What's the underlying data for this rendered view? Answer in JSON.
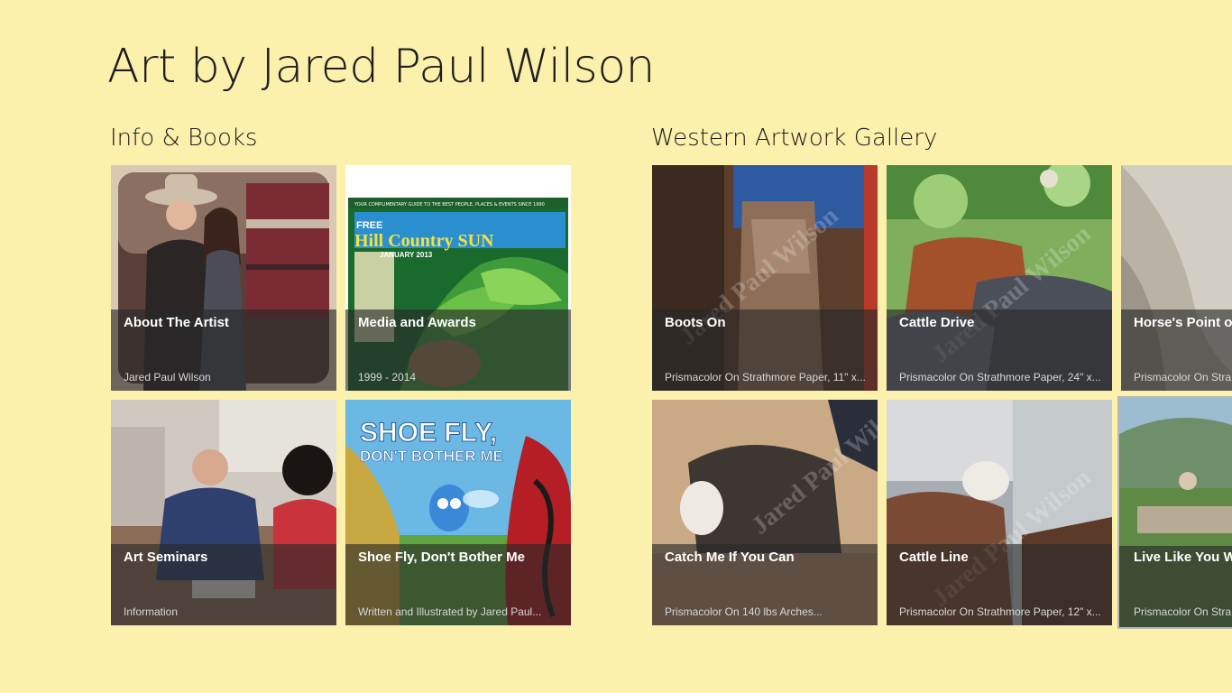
{
  "app_title": "Art by Jared Paul Wilson",
  "sections": {
    "info": {
      "header": "Info & Books",
      "tiles": [
        {
          "title": "About The Artist",
          "subtitle": "Jared Paul Wilson"
        },
        {
          "title": "Media and Awards",
          "subtitle": "1999 - 2014"
        },
        {
          "title": "Art Seminars",
          "subtitle": "Information"
        },
        {
          "title": "Shoe Fly, Don't Bother Me",
          "subtitle": "Written and Illustrated by Jared Paul..."
        }
      ]
    },
    "gallery": {
      "header": "Western Artwork Gallery",
      "tiles": [
        {
          "title": "Boots On",
          "subtitle": "Prismacolor On Strathmore Paper, 11\" x..."
        },
        {
          "title": "Cattle Drive",
          "subtitle": "Prismacolor On Strathmore Paper, 24\" x..."
        },
        {
          "title": "Horse's Point of",
          "subtitle": "Prismacolor On Stra"
        },
        {
          "title": "Catch Me If You Can",
          "subtitle": "Prismacolor On 140 lbs Arches..."
        },
        {
          "title": "Cattle Line",
          "subtitle": "Prismacolor On Strathmore Paper, 12\" x..."
        },
        {
          "title": "Live Like You We",
          "subtitle": "Prismacolor On Stra"
        }
      ]
    }
  },
  "magazine": {
    "banner": "YOUR COMPLIMENTARY GUIDE TO THE BEST PEOPLE, PLACES & EVENTS SINCE 1990",
    "free": "FREE",
    "name": "Hill Country SUN",
    "issue": "JANUARY 2013"
  },
  "book_cover": {
    "line1": "SHOE FLY,",
    "line2": "DON'T BOTHER ME"
  },
  "watermark": "Jared Paul Wilson",
  "colors": {
    "background": "#fbf0ac",
    "overlay": "rgba(40,40,40,0.62)",
    "title_text": "#ffffff",
    "subtitle_text": "#d8d8d8"
  }
}
